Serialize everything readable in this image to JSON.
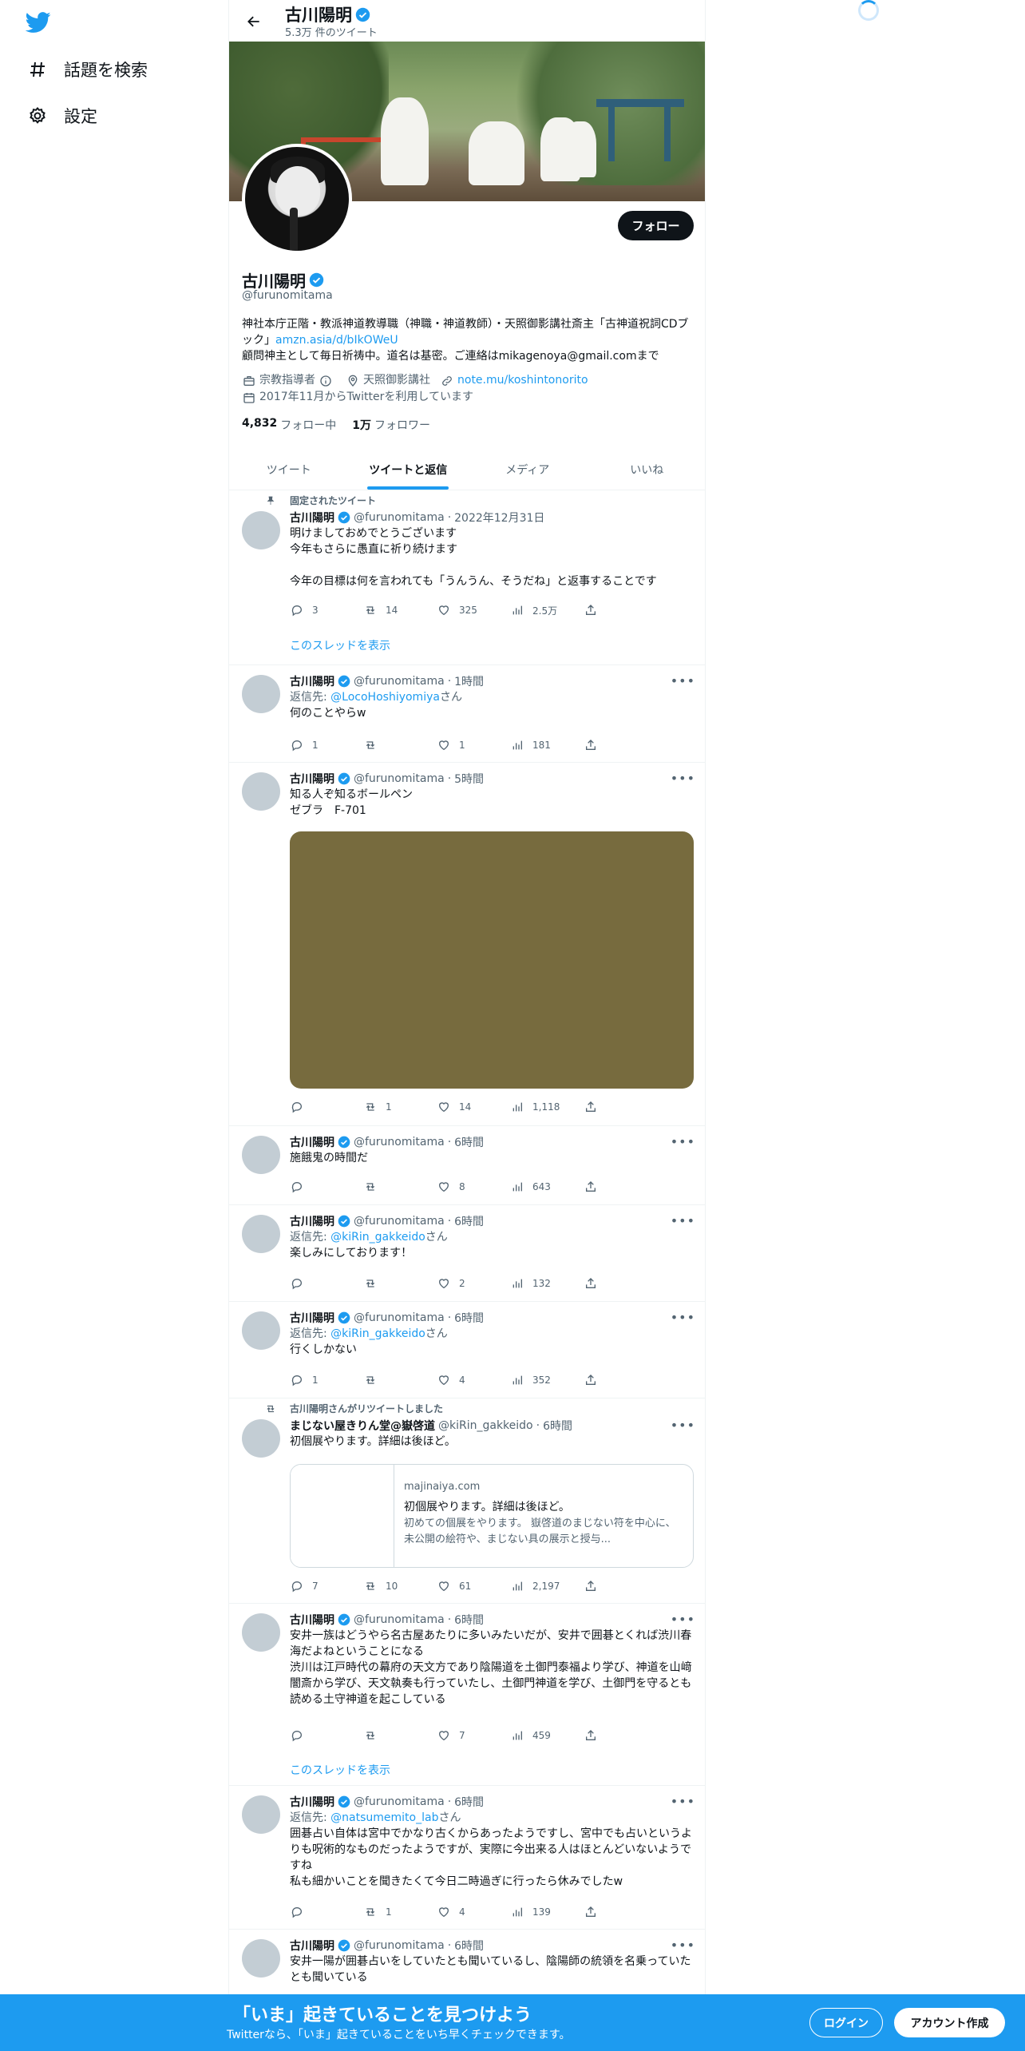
{
  "nav": {
    "explore_label": "話題を検索",
    "settings_label": "設定"
  },
  "header": {
    "name": "古川陽明",
    "tweet_count": "5.3万 件のツイート"
  },
  "profile": {
    "name": "古川陽明",
    "handle": "@furunomitama",
    "follow_label": "フォロー",
    "bio_line1": "神社本庁正階・教派神道教導職（神職・神道教師）・天照御影講社斎主「古神道祝詞CDブック」",
    "bio_link": "amzn.asia/d/bIkOWeU",
    "bio_line2": "顧問神主として毎日祈祷中。道名は基密。ご連絡はmikagenoya@gmail.comまで",
    "category": "宗教指導者",
    "location": "天照御影講社",
    "website": "note.mu/koshintonorito",
    "joined": "2017年11月からTwitterを利用しています",
    "following_count": "4,832",
    "following_label": "フォロー中",
    "followers_count": "1万",
    "followers_label": "フォロワー"
  },
  "tabs": [
    "ツイート",
    "ツイートと返信",
    "メディア",
    "いいね"
  ],
  "active_tab": 1,
  "pinned_label": "固定されたツイート",
  "retweet_label": "古川陽明さんがリツイートしました",
  "thread_label": "このスレッドを表示",
  "reply_prefix": "返信先: ",
  "reply_suffix": "さん",
  "tweets": [
    {
      "name": "古川陽明",
      "handle": "@furunomitama",
      "time": "2022年12月31日",
      "text": "明けましておめでとうございます\n今年もさらに愚直に祈り続けます\n\n今年の目標は何を言われても「うんうん、そうだね」と返事することです",
      "replies": "3",
      "retweets": "14",
      "likes": "325",
      "views": "2.5万"
    },
    {
      "name": "古川陽明",
      "handle": "@furunomitama",
      "time": "1時間",
      "reply_to": "@LocoHoshiyomiya",
      "text": "何のことやらw",
      "replies": "1",
      "retweets": "",
      "likes": "1",
      "views": "181"
    },
    {
      "name": "古川陽明",
      "handle": "@furunomitama",
      "time": "5時間",
      "text": "知る人ぞ知るボールペン\nゼブラ　F-701",
      "replies": "",
      "retweets": "1",
      "likes": "14",
      "views": "1,118"
    },
    {
      "name": "古川陽明",
      "handle": "@furunomitama",
      "time": "6時間",
      "text": "施餓鬼の時間だ",
      "replies": "",
      "retweets": "",
      "likes": "8",
      "views": "643"
    },
    {
      "name": "古川陽明",
      "handle": "@furunomitama",
      "time": "6時間",
      "reply_to": "@kiRin_gakkeido",
      "text": "楽しみにしております！",
      "replies": "",
      "retweets": "",
      "likes": "2",
      "views": "132"
    },
    {
      "name": "古川陽明",
      "handle": "@furunomitama",
      "time": "6時間",
      "reply_to": "@kiRin_gakkeido",
      "text": "行くしかない",
      "replies": "1",
      "retweets": "",
      "likes": "4",
      "views": "352"
    },
    {
      "name": "まじない屋きりん堂@嶽啓道",
      "handle": "@kiRin_gakkeido",
      "time": "6時間",
      "text": "初個展やります。詳細は後ほど。",
      "card_domain": "majinaiya.com",
      "card_title": "初個展やります。詳細は後ほど。",
      "card_desc": "初めての個展をやります。 嶽啓道のまじない符を中心に、未公開の絵符や、まじない具の展示と授与...",
      "replies": "7",
      "retweets": "10",
      "likes": "61",
      "views": "2,197"
    },
    {
      "name": "古川陽明",
      "handle": "@furunomitama",
      "time": "6時間",
      "text": "安井一族はどうやら名古屋あたりに多いみたいだが、安井で囲碁とくれば渋川春海だよねということになる\n渋川は江戸時代の幕府の天文方であり陰陽道を土御門泰福より学び、神道を山﨑闇斎から学び、天文執奏も行っていたし、土御門神道を学び、土御門を守るとも読める土守神道を起こしている",
      "replies": "",
      "retweets": "",
      "likes": "7",
      "views": "459"
    },
    {
      "name": "古川陽明",
      "handle": "@furunomitama",
      "time": "6時間",
      "reply_to": "@natsumemito_lab",
      "text": "囲碁占い自体は宮中でかなり古くからあったようですし、宮中でも占いというよりも呪術的なものだったようですが、実際に今出来る人はほとんどいないようですね\n私も細かいことを聞きたくて今日二時過ぎに行ったら休みでしたw",
      "replies": "",
      "retweets": "1",
      "likes": "4",
      "views": "139"
    },
    {
      "name": "古川陽明",
      "handle": "@furunomitama",
      "time": "6時間",
      "text": "安井一陽が囲碁占いをしていたとも聞いているし、陰陽師の統領を名乗っていたとも聞いている"
    }
  ],
  "bottom_bar": {
    "title": "「いま」起きていることを見つけよう",
    "subtitle": "Twitterなら、「いま」起きていることをいち早くチェックできます。",
    "login_label": "ログイン",
    "signup_label": "アカウント作成"
  },
  "colors": {
    "accent": "#1d9bf0",
    "text": "#0f1419",
    "muted": "#536471",
    "media_placeholder": "#776b3e"
  }
}
